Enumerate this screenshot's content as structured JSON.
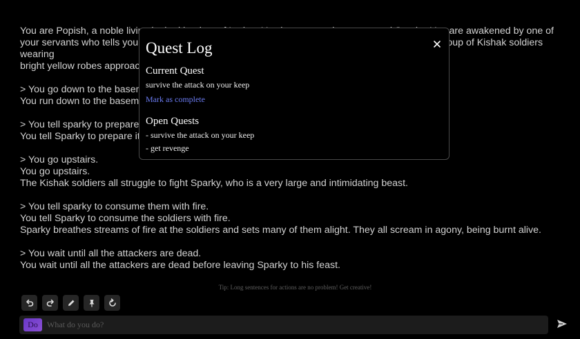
{
  "story": {
    "paragraphs": [
      "You are Popish, a noble living in the kingdom of Larion. You have a pet dragon named Sparky. You are awakened by one of\nyour servants who tells you that your keep is being attacked. You look out the window and see a group of Kishak soldiers wearing\nbright yellow robes approaching your keep.",
      "> You go down to the basement.\nYou run down to the basement, where Sparky is sleeping.",
      "> You tell sparky to prepare itself.\nYou tell Sparky to prepare itself for battle.",
      "> You go upstairs.\nYou go upstairs.\nThe Kishak soldiers all struggle to fight Sparky, who is a very large and intimidating beast.",
      "> You tell sparky to consume them with fire.\nYou tell Sparky to consume the soldiers with fire.\nSparky breathes streams of fire at the soldiers and sets many of them alight. They all scream in agony, being burnt alive.",
      "> You wait until all the attackers are dead.\nYou wait until all the attackers are dead before leaving Sparky to his feast."
    ]
  },
  "quest_log": {
    "title": "Quest Log",
    "close_icon": "close-icon",
    "current_heading": "Current Quest",
    "current_quest": "survive the attack on your keep",
    "mark_complete": "Mark as complete",
    "open_heading": "Open Quests",
    "open_quests": [
      "- survive the attack on your keep",
      "- get revenge"
    ]
  },
  "tip": "Tip: Long sentences for actions are no problem! Get creative!",
  "toolbar": {
    "icons": [
      "undo-icon",
      "redo-icon",
      "pencil-icon",
      "pin-icon",
      "refresh-icon"
    ]
  },
  "input": {
    "mode_label": "Do",
    "placeholder": "What do you do?",
    "value": "",
    "send_icon": "send-icon"
  },
  "colors": {
    "background": "#000000",
    "link": "#6b7cf2",
    "mode_button": "#7a44d0"
  }
}
